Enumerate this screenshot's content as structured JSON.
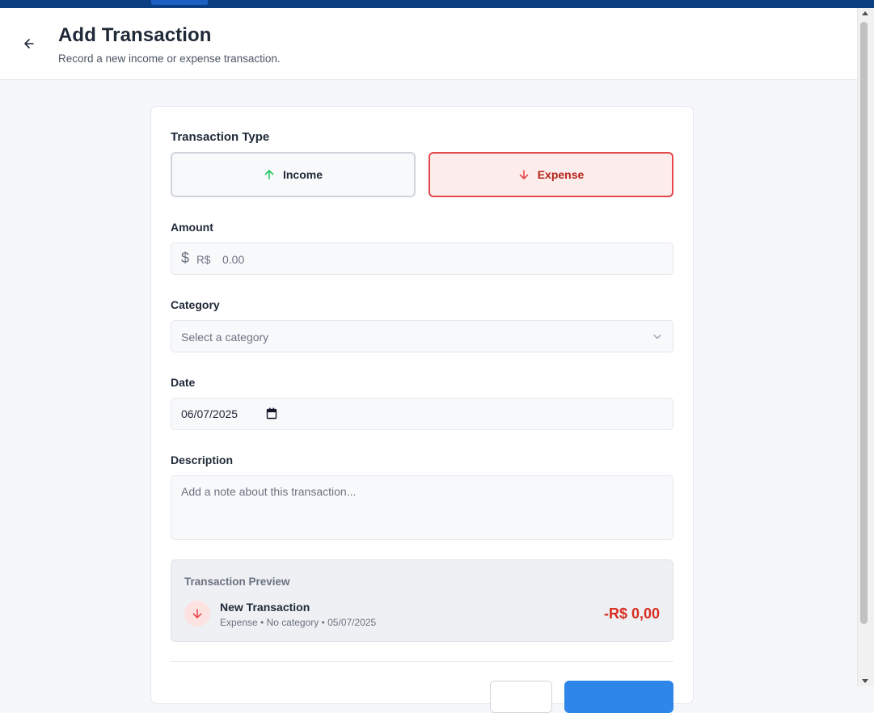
{
  "header": {
    "title": "Add Transaction",
    "subtitle": "Record a new income or expense transaction.",
    "back_icon": "arrow-left-icon"
  },
  "form": {
    "type_label": "Transaction Type",
    "types": [
      {
        "label": "Income",
        "icon": "arrow-up-icon",
        "color": "#22c55e",
        "selected": false
      },
      {
        "label": "Expense",
        "icon": "arrow-down-icon",
        "color": "#e5484d",
        "selected": true
      }
    ],
    "amount_label": "Amount",
    "amount_currency_symbol": "$",
    "amount_currency": "R$",
    "amount_placeholder": "0.00",
    "category_label": "Category",
    "category_placeholder": "Select a category",
    "date_label": "Date",
    "date_value": "06/07/2025",
    "description_label": "Description",
    "description_placeholder": "Add a note about this transaction..."
  },
  "preview": {
    "title": "Transaction Preview",
    "name": "New Transaction",
    "meta": "Expense • No category • 05/07/2025",
    "amount": "-R$ 0,00",
    "amount_color": "#d92d20",
    "icon": "arrow-down-icon"
  },
  "colors": {
    "topbar": "#0b3f82",
    "expense_accent": "#e5484d",
    "primary_button": "#2e86e8"
  }
}
